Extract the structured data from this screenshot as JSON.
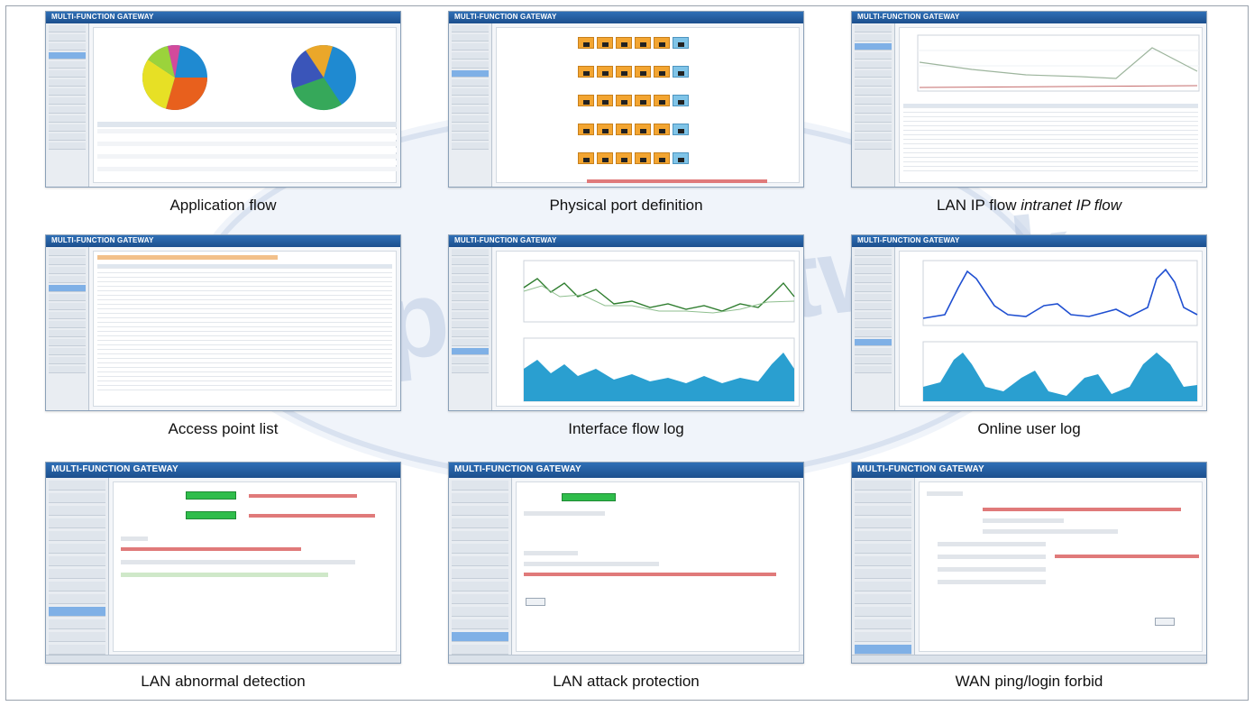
{
  "panels": [
    {
      "id": "app-flow",
      "caption": "Application flow",
      "brand": "MULTI-FUNCTION GATEWAY"
    },
    {
      "id": "port-def",
      "caption": "Physical port definition",
      "brand": "MULTI-FUNCTION GATEWAY"
    },
    {
      "id": "lan-ip-flow",
      "caption": "LAN IP flow ",
      "caption_em": "intranet IP flow",
      "brand": "MULTI-FUNCTION GATEWAY"
    },
    {
      "id": "ap-list",
      "caption": "Access point list",
      "brand": "MULTI-FUNCTION GATEWAY"
    },
    {
      "id": "if-flow-log",
      "caption": "Interface flow log",
      "brand": "MULTI-FUNCTION GATEWAY"
    },
    {
      "id": "online-user",
      "caption": "Online user log",
      "brand": "MULTI-FUNCTION GATEWAY"
    },
    {
      "id": "lan-abnormal",
      "caption": "LAN abnormal detection",
      "brand": "MULTI-FUNCTION GATEWAY"
    },
    {
      "id": "lan-attack",
      "caption": "LAN attack protection",
      "brand": "MULTI-FUNCTION GATEWAY"
    },
    {
      "id": "wan-ping",
      "caption": "WAN ping/login forbid",
      "brand": "MULTI-FUNCTION GATEWAY"
    }
  ],
  "colors": {
    "chrome_blue": "#1c4f8d",
    "accent_orange": "#f3a531",
    "chart_blue": "#1f4fd1",
    "area_blue": "#2a9fd0",
    "line_green": "#2e7d2e",
    "status_green": "#2fbd4b"
  }
}
